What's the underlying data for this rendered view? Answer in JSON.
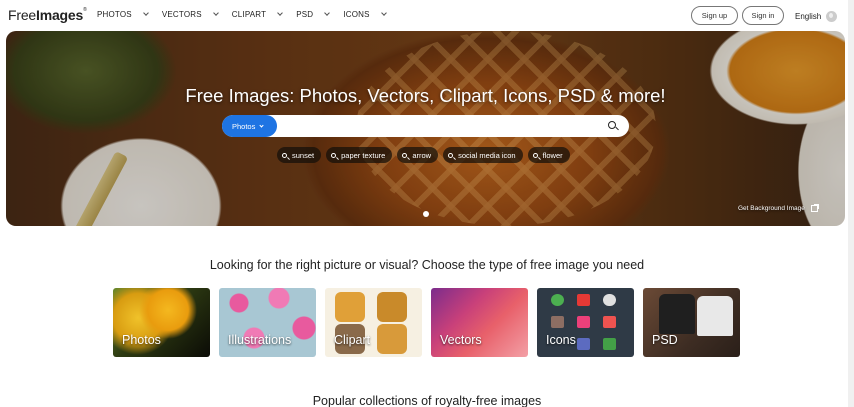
{
  "header": {
    "logo_light": "Free",
    "logo_bold": "Images",
    "logo_mark": "®",
    "nav": [
      {
        "label": "PHOTOS"
      },
      {
        "label": "VECTORS"
      },
      {
        "label": "CLIPART"
      },
      {
        "label": "PSD"
      },
      {
        "label": "ICONS"
      }
    ],
    "signup_label": "Sign up",
    "signin_label": "Sign in",
    "language": "English"
  },
  "hero": {
    "title": "Free Images: Photos, Vectors, Clipart, Icons, PSD & more!",
    "search": {
      "type_label": "Photos",
      "value": "",
      "placeholder": ""
    },
    "tags": [
      {
        "label": "sunset"
      },
      {
        "label": "paper texture"
      },
      {
        "label": "arrow"
      },
      {
        "label": "social media icon"
      },
      {
        "label": "flower"
      }
    ],
    "background_link": "Get Background Image"
  },
  "types": {
    "title": "Looking for the right picture or visual? Choose the type of free image you need",
    "cards": [
      {
        "label": "Photos"
      },
      {
        "label": "Illustrations"
      },
      {
        "label": "Clipart"
      },
      {
        "label": "Vectors"
      },
      {
        "label": "Icons"
      },
      {
        "label": "PSD"
      }
    ]
  },
  "collections": {
    "title": "Popular collections of royalty-free images"
  },
  "colors": {
    "accent": "#1e74e3",
    "text": "#222222"
  }
}
